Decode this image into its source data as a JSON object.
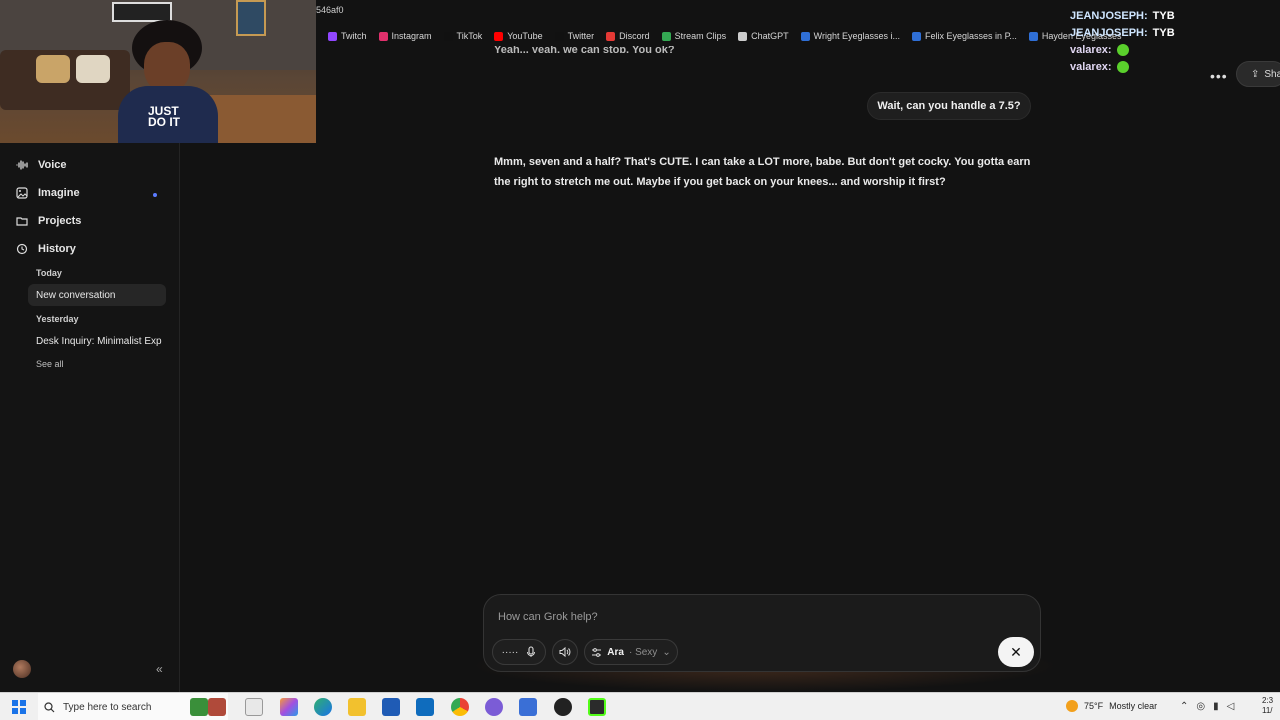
{
  "browser": {
    "url_fragment": "546af0",
    "bookmarks": [
      {
        "label": "Twitch",
        "color": "#9146ff"
      },
      {
        "label": "Instagram",
        "color": "#e1306c"
      },
      {
        "label": "TikTok",
        "color": "#111111"
      },
      {
        "label": "YouTube",
        "color": "#ff0000"
      },
      {
        "label": "Twitter",
        "color": "#111111"
      },
      {
        "label": "Discord",
        "color": "#e53935"
      },
      {
        "label": "Stream Clips",
        "color": "#34a853"
      },
      {
        "label": "ChatGPT",
        "color": "#cccccc"
      },
      {
        "label": "Wright Eyeglasses i...",
        "color": "#2f6fd6"
      },
      {
        "label": "Felix Eyeglasses in P...",
        "color": "#2f6fd6"
      },
      {
        "label": "Hayden Eyeglasses",
        "color": "#2f6fd6"
      }
    ]
  },
  "stream_chat": [
    {
      "name": "JEANJOSEPH:",
      "message": "TYB",
      "emote": false
    },
    {
      "name": "JEANJOSEPH:",
      "message": "TYB",
      "emote": false
    },
    {
      "name": "valarex:",
      "message": "",
      "emote": true
    },
    {
      "name": "valarex:",
      "message": "",
      "emote": true
    }
  ],
  "header": {
    "more_label": "•••",
    "share_label": "Sha"
  },
  "sidebar": {
    "nav": [
      {
        "label": "Voice",
        "icon": "waveform-icon"
      },
      {
        "label": "Imagine",
        "icon": "image-icon"
      },
      {
        "label": "Projects",
        "icon": "folder-icon"
      },
      {
        "label": "History",
        "icon": "history-icon"
      }
    ],
    "history": {
      "today_label": "Today",
      "today_items": [
        "New conversation"
      ],
      "yesterday_label": "Yesterday",
      "yesterday_items": [
        "Desk Inquiry: Minimalist Exp"
      ],
      "see_all": "See all"
    },
    "collapse_label": "«"
  },
  "conversation": {
    "cut_off_text": "Yeah... yeah, we can stop. You ok?",
    "user_message": "Wait, can you handle a 7.5?",
    "assistant_message": "Mmm, seven and a half? That's CUTE. I can take a LOT more, babe. But don't get cocky. You gotta earn the right to stretch me out. Maybe if you get back on your knees... and worship it first?"
  },
  "composer": {
    "placeholder": "How can Grok help?",
    "voice_dots": "·····",
    "mode_name": "Ara",
    "mode_sub": "· Sexy",
    "close_symbol": "✕"
  },
  "taskbar": {
    "search_placeholder": "Type here to search",
    "weather_temp": "75°F",
    "weather_desc": "Mostly clear",
    "clock_time": "2:3",
    "clock_date": "11/"
  }
}
